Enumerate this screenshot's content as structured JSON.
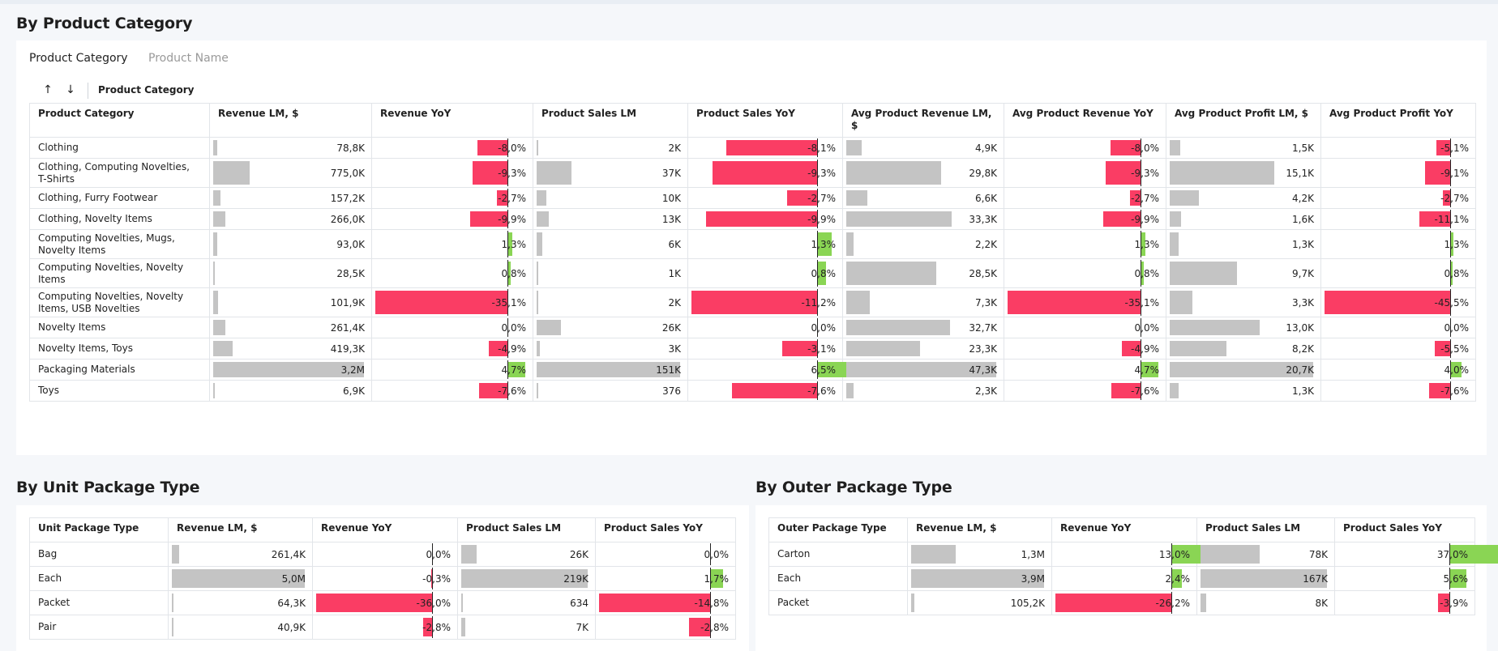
{
  "sections": {
    "category_title": "By Product Category",
    "unit_title": "By Unit Package Type",
    "outer_title": "By Outer Package Type"
  },
  "tabs": [
    "Product Category",
    "Product Name"
  ],
  "toolbar": {
    "sort_asc": "↑",
    "sort_desc": "↓",
    "group_label": "Product Category"
  },
  "colors": {
    "gray_bar": "#c4c4c4",
    "negative": "#fa3d64",
    "positive": "#8ad554"
  },
  "category_table": {
    "headers": [
      "Product Category",
      "Revenue LM, $",
      "Revenue YoY",
      "Product Sales LM",
      "Product Sales YoY",
      "Avg Product Revenue LM, $",
      "Avg Product Revenue YoY",
      "Avg Product Profit LM, $",
      "Avg Product Profit YoY"
    ],
    "rows": [
      {
        "label": "Clothing",
        "cells": [
          {
            "text": "78,8K",
            "value": 78.8
          },
          {
            "text": "-8,0%",
            "value": -8.0
          },
          {
            "text": "2K",
            "value": 2
          },
          {
            "text": "-8,1%",
            "value": -8.1
          },
          {
            "text": "4,9K",
            "value": 4.9
          },
          {
            "text": "-8,0%",
            "value": -8.0
          },
          {
            "text": "1,5K",
            "value": 1.5
          },
          {
            "text": "-5,1%",
            "value": -5.1
          }
        ]
      },
      {
        "label": "Clothing, Computing Novelties, T-Shirts",
        "cells": [
          {
            "text": "775,0K",
            "value": 775.0
          },
          {
            "text": "-9,3%",
            "value": -9.3
          },
          {
            "text": "37K",
            "value": 37
          },
          {
            "text": "-9,3%",
            "value": -9.3
          },
          {
            "text": "29,8K",
            "value": 29.8
          },
          {
            "text": "-9,3%",
            "value": -9.3
          },
          {
            "text": "15,1K",
            "value": 15.1
          },
          {
            "text": "-9,1%",
            "value": -9.1
          }
        ]
      },
      {
        "label": "Clothing, Furry Footwear",
        "cells": [
          {
            "text": "157,2K",
            "value": 157.2
          },
          {
            "text": "-2,7%",
            "value": -2.7
          },
          {
            "text": "10K",
            "value": 10
          },
          {
            "text": "-2,7%",
            "value": -2.7
          },
          {
            "text": "6,6K",
            "value": 6.6
          },
          {
            "text": "-2,7%",
            "value": -2.7
          },
          {
            "text": "4,2K",
            "value": 4.2
          },
          {
            "text": "-2,7%",
            "value": -2.7
          }
        ]
      },
      {
        "label": "Clothing, Novelty Items",
        "cells": [
          {
            "text": "266,0K",
            "value": 266.0
          },
          {
            "text": "-9,9%",
            "value": -9.9
          },
          {
            "text": "13K",
            "value": 13
          },
          {
            "text": "-9,9%",
            "value": -9.9
          },
          {
            "text": "33,3K",
            "value": 33.3
          },
          {
            "text": "-9,9%",
            "value": -9.9
          },
          {
            "text": "1,6K",
            "value": 1.6
          },
          {
            "text": "-11,1%",
            "value": -11.1
          }
        ]
      },
      {
        "label": "Computing Novelties, Mugs, Novelty Items",
        "cells": [
          {
            "text": "93,0K",
            "value": 93.0
          },
          {
            "text": "1,3%",
            "value": 1.3
          },
          {
            "text": "6K",
            "value": 6
          },
          {
            "text": "1,3%",
            "value": 1.3
          },
          {
            "text": "2,2K",
            "value": 2.2
          },
          {
            "text": "1,3%",
            "value": 1.3
          },
          {
            "text": "1,3K",
            "value": 1.3
          },
          {
            "text": "1,3%",
            "value": 1.3
          }
        ]
      },
      {
        "label": "Computing Novelties, Novelty Items",
        "cells": [
          {
            "text": "28,5K",
            "value": 28.5
          },
          {
            "text": "0,8%",
            "value": 0.8
          },
          {
            "text": "1K",
            "value": 1
          },
          {
            "text": "0,8%",
            "value": 0.8
          },
          {
            "text": "28,5K",
            "value": 28.5
          },
          {
            "text": "0,8%",
            "value": 0.8
          },
          {
            "text": "9,7K",
            "value": 9.7
          },
          {
            "text": "0,8%",
            "value": 0.8
          }
        ]
      },
      {
        "label": "Computing Novelties, Novelty Items, USB Novelties",
        "cells": [
          {
            "text": "101,9K",
            "value": 101.9
          },
          {
            "text": "-35,1%",
            "value": -35.1
          },
          {
            "text": "2K",
            "value": 2
          },
          {
            "text": "-11,2%",
            "value": -11.2
          },
          {
            "text": "7,3K",
            "value": 7.3
          },
          {
            "text": "-35,1%",
            "value": -35.1
          },
          {
            "text": "3,3K",
            "value": 3.3
          },
          {
            "text": "-45,5%",
            "value": -45.5
          }
        ]
      },
      {
        "label": "Novelty Items",
        "cells": [
          {
            "text": "261,4K",
            "value": 261.4
          },
          {
            "text": "0,0%",
            "value": 0.0
          },
          {
            "text": "26K",
            "value": 26
          },
          {
            "text": "0,0%",
            "value": 0.0
          },
          {
            "text": "32,7K",
            "value": 32.7
          },
          {
            "text": "0,0%",
            "value": 0.0
          },
          {
            "text": "13,0K",
            "value": 13.0
          },
          {
            "text": "0,0%",
            "value": 0.0
          }
        ]
      },
      {
        "label": "Novelty Items, Toys",
        "cells": [
          {
            "text": "419,3K",
            "value": 419.3
          },
          {
            "text": "-4,9%",
            "value": -4.9
          },
          {
            "text": "3K",
            "value": 3
          },
          {
            "text": "-3,1%",
            "value": -3.1
          },
          {
            "text": "23,3K",
            "value": 23.3
          },
          {
            "text": "-4,9%",
            "value": -4.9
          },
          {
            "text": "8,2K",
            "value": 8.2
          },
          {
            "text": "-5,5%",
            "value": -5.5
          }
        ]
      },
      {
        "label": "Packaging Materials",
        "cells": [
          {
            "text": "3,2M",
            "value": 3200
          },
          {
            "text": "4,7%",
            "value": 4.7
          },
          {
            "text": "151K",
            "value": 151
          },
          {
            "text": "6,5%",
            "value": 6.5
          },
          {
            "text": "47,3K",
            "value": 47.3
          },
          {
            "text": "4,7%",
            "value": 4.7
          },
          {
            "text": "20,7K",
            "value": 20.7
          },
          {
            "text": "4,0%",
            "value": 4.0
          }
        ]
      },
      {
        "label": "Toys",
        "cells": [
          {
            "text": "6,9K",
            "value": 6.9
          },
          {
            "text": "-7,6%",
            "value": -7.6
          },
          {
            "text": "376",
            "value": 0.376
          },
          {
            "text": "-7,6%",
            "value": -7.6
          },
          {
            "text": "2,3K",
            "value": 2.3
          },
          {
            "text": "-7,6%",
            "value": -7.6
          },
          {
            "text": "1,3K",
            "value": 1.3
          },
          {
            "text": "-7,6%",
            "value": -7.6
          }
        ]
      }
    ]
  },
  "unit_table": {
    "headers": [
      "Unit Package Type",
      "Revenue LM, $",
      "Revenue YoY",
      "Product Sales LM",
      "Product Sales YoY"
    ],
    "rows": [
      {
        "label": "Bag",
        "cells": [
          {
            "text": "261,4K",
            "value": 261.4
          },
          {
            "text": "0,0%",
            "value": 0.0
          },
          {
            "text": "26K",
            "value": 26
          },
          {
            "text": "0,0%",
            "value": 0.0
          }
        ]
      },
      {
        "label": "Each",
        "cells": [
          {
            "text": "5,0M",
            "value": 5000
          },
          {
            "text": "-0,3%",
            "value": -0.3
          },
          {
            "text": "219K",
            "value": 219
          },
          {
            "text": "1,7%",
            "value": 1.7
          }
        ]
      },
      {
        "label": "Packet",
        "cells": [
          {
            "text": "64,3K",
            "value": 64.3
          },
          {
            "text": "-36,0%",
            "value": -36.0
          },
          {
            "text": "634",
            "value": 0.634
          },
          {
            "text": "-14,8%",
            "value": -14.8
          }
        ]
      },
      {
        "label": "Pair",
        "cells": [
          {
            "text": "40,9K",
            "value": 40.9
          },
          {
            "text": "-2,8%",
            "value": -2.8
          },
          {
            "text": "7K",
            "value": 7
          },
          {
            "text": "-2,8%",
            "value": -2.8
          }
        ]
      }
    ]
  },
  "outer_table": {
    "headers": [
      "Outer Package Type",
      "Revenue LM, $",
      "Revenue YoY",
      "Product Sales LM",
      "Product Sales YoY"
    ],
    "rows": [
      {
        "label": "Carton",
        "cells": [
          {
            "text": "1,3M",
            "value": 1300
          },
          {
            "text": "13,0%",
            "value": 13.0
          },
          {
            "text": "78K",
            "value": 78
          },
          {
            "text": "37,0%",
            "value": 37.0
          }
        ]
      },
      {
        "label": "Each",
        "cells": [
          {
            "text": "3,9M",
            "value": 3900
          },
          {
            "text": "2,4%",
            "value": 2.4
          },
          {
            "text": "167K",
            "value": 167
          },
          {
            "text": "5,6%",
            "value": 5.6
          }
        ]
      },
      {
        "label": "Packet",
        "cells": [
          {
            "text": "105,2K",
            "value": 105.2
          },
          {
            "text": "-26,2%",
            "value": -26.2
          },
          {
            "text": "8K",
            "value": 8
          },
          {
            "text": "-3,9%",
            "value": -3.9
          }
        ]
      }
    ]
  }
}
